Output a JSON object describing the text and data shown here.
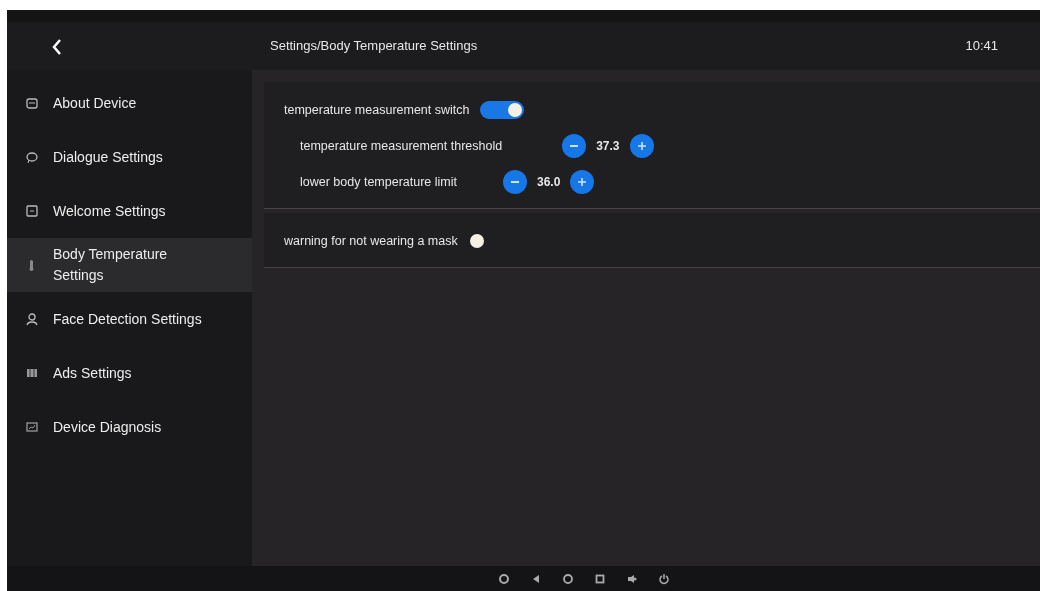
{
  "header": {
    "title": "Settings/Body Temperature Settings",
    "time": "10:41"
  },
  "sidebar": {
    "items": [
      {
        "label": "About Device",
        "selected": false
      },
      {
        "label": "Dialogue Settings",
        "selected": false
      },
      {
        "label": "Welcome Settings",
        "selected": false
      },
      {
        "label": "Body Temperature Settings",
        "selected": true
      },
      {
        "label": "Face Detection Settings",
        "selected": false
      },
      {
        "label": "Ads Settings",
        "selected": false
      },
      {
        "label": "Device Diagnosis",
        "selected": false
      }
    ]
  },
  "sections": [
    {
      "rows": [
        {
          "kind": "switch",
          "label": "temperature measurement switch",
          "on": true
        },
        {
          "kind": "stepper",
          "label": "temperature measurement threshold",
          "value": "37.3"
        },
        {
          "kind": "stepper",
          "label": "lower body temperature limit",
          "value": "36.0"
        }
      ]
    },
    {
      "rows": [
        {
          "kind": "switch",
          "label": "warning for not wearing a mask",
          "on": false
        }
      ]
    }
  ]
}
